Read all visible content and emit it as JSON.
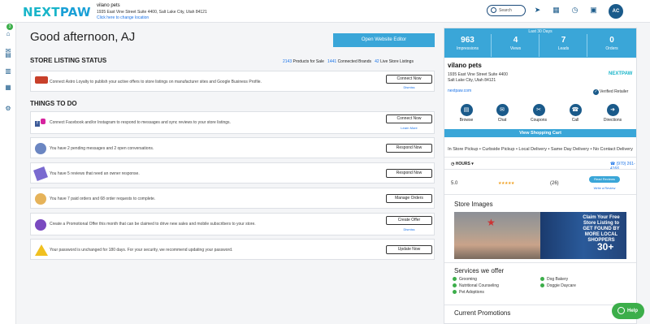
{
  "header": {
    "logo_left": "NEXT",
    "logo_right": "PAW",
    "store_name": "vilano pets",
    "store_address": "1935 East Vine Street Suite 4400, Salt Lake City, Utah 84121",
    "change_location": "Click here to change location",
    "search_placeholder": "Search",
    "avatar_initials": "AC"
  },
  "rail": {
    "badge_count": "3"
  },
  "main": {
    "greeting": "Good afternoon, AJ",
    "open_editor_button": "Open Website Editor",
    "store_listing_title": "STORE LISTING STATUS",
    "stats": {
      "products_count": "2143",
      "products_label": "Products for Sale",
      "brands_count": "1441",
      "brands_label": "Connected Brands",
      "listings_count": "42",
      "listings_label": "Live Store Listings"
    },
    "listing_card": {
      "text": "Connect Astro Loyalty to publish your active offers to store listings on manufacturer sites and Google Business Profile.",
      "button": "Connect Now",
      "sub": "Dismiss"
    },
    "todo_title": "THINGS TO DO",
    "todos": [
      {
        "text": "Connect Facebook and/or Instagram to respond to messages and sync reviews to your store listings.",
        "button": "Connect Now",
        "sub": "Learn More"
      },
      {
        "text": "You have 2 pending messages and 2 open conversations.",
        "button": "Respond Now",
        "sub": ""
      },
      {
        "text": "You have 5 reviews that need an owner response.",
        "button": "Respond Now",
        "sub": ""
      },
      {
        "text": "You have 7 paid orders and 68 order requests to complete.",
        "button": "Manage Orders",
        "sub": ""
      },
      {
        "text": "Create a Promotional Offer this month that can be claimed to drive new sales and mobile subscribers to your store.",
        "button": "Create Offer",
        "sub": "Dismiss"
      },
      {
        "text": "Your password is unchanged for 180 days. For your security, we recommend updating your password.",
        "button": "Update Now",
        "sub": ""
      }
    ]
  },
  "panel": {
    "period": "Last 30 Days",
    "kpis": [
      {
        "value": "963",
        "label": "Impressions"
      },
      {
        "value": "4",
        "label": "Views"
      },
      {
        "value": "7",
        "label": "Leads"
      },
      {
        "value": "0",
        "label": "Orders"
      }
    ],
    "store_name": "vilano pets",
    "address_line1": "1935 East Vine Street Suite 4400",
    "address_line2": "Salt Lake City, Utah 84121",
    "website": "nextpaw.com",
    "verified": "Verified Retailer",
    "actions": [
      "Browse",
      "Chat",
      "Coupons",
      "Call",
      "Directions"
    ],
    "shop_cart": "View Shopping Cart",
    "pickup": "In Store Pickup • Curbside Pickup • Local Delivery • Same Day Delivery • No Contact Delivery",
    "hours": "HOURS",
    "phone": "(970) 261-4166",
    "rating_value": "5.0",
    "stars": "★★★★★",
    "rating_count": "(26)",
    "read_reviews": "Read Reviews",
    "write_review": "Write a Review",
    "store_images_title": "Store Images",
    "image_banner": "Claim Your Free Store Listing to GET FOUND BY MORE LOCAL SHOPPERS",
    "image_counter": "30+",
    "services_title": "Services we offer",
    "services_left": [
      "Grooming",
      "Nutritional Counseling",
      "Pet Adoptions"
    ],
    "services_right": [
      "Dog Bakery",
      "Doggie Daycare"
    ],
    "promotions_title": "Current Promotions"
  },
  "help": "Help"
}
